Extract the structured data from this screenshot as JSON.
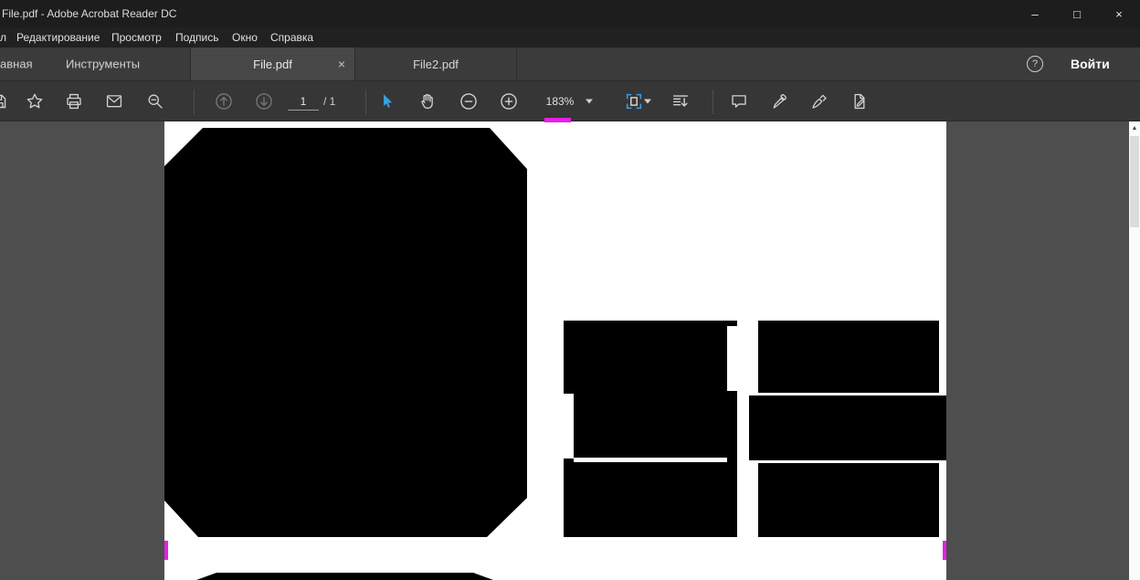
{
  "window": {
    "title": "File.pdf - Adobe Acrobat Reader DC",
    "minimize_glyph": "–",
    "maximize_glyph": "□",
    "close_glyph": "×"
  },
  "menubar": {
    "items": [
      "л",
      "Редактирование",
      "Просмотр",
      "Подпись",
      "Окно",
      "Справка"
    ]
  },
  "tabbar": {
    "home_label": "авная",
    "tools_label": "Инструменты",
    "doc_tabs": [
      {
        "label": "File.pdf",
        "close_glyph": "×"
      },
      {
        "label": "File2.pdf"
      }
    ],
    "help_glyph": "?",
    "sign_in_label": "Войти"
  },
  "toolbar": {
    "page_current": "1",
    "page_total_label": "/ 1",
    "zoom_level": "183%"
  },
  "icons": {
    "save": "floppy-disk (left-clipped)",
    "favorites": "star-outline",
    "print": "printer",
    "email": "envelope",
    "zoom_tool": "magnifier-with-minus",
    "prev_page": "circle-arrow-up (disabled)",
    "next_page": "circle-arrow-down (disabled)",
    "select_tool": "blue-cursor-arrow",
    "hand_tool": "hand",
    "zoom_out": "circle-minus",
    "zoom_in": "circle-plus",
    "page_fit": "page-with-blue-corner-brackets",
    "read_mode": "text-lines-with-down-arrow",
    "comment": "speech-bubble",
    "highlight": "highlighter-pen",
    "fill_sign": "signature-pen",
    "edit_tools": "page-with-pencil",
    "help": "circled-question",
    "dropdown_caret": "▾",
    "scroll_up": "▲"
  },
  "colors": {
    "accent_blue": "#3aa0e0",
    "magenta_mark": "#e620e6",
    "icon_gray": "#d2d2d2",
    "disabled_gray": "#777777",
    "page_white": "#ffffff",
    "canvas_gray": "#4e4e4e",
    "titlebar_dark": "#1d1d1d",
    "tabbar_gray": "#3b3b3b"
  }
}
